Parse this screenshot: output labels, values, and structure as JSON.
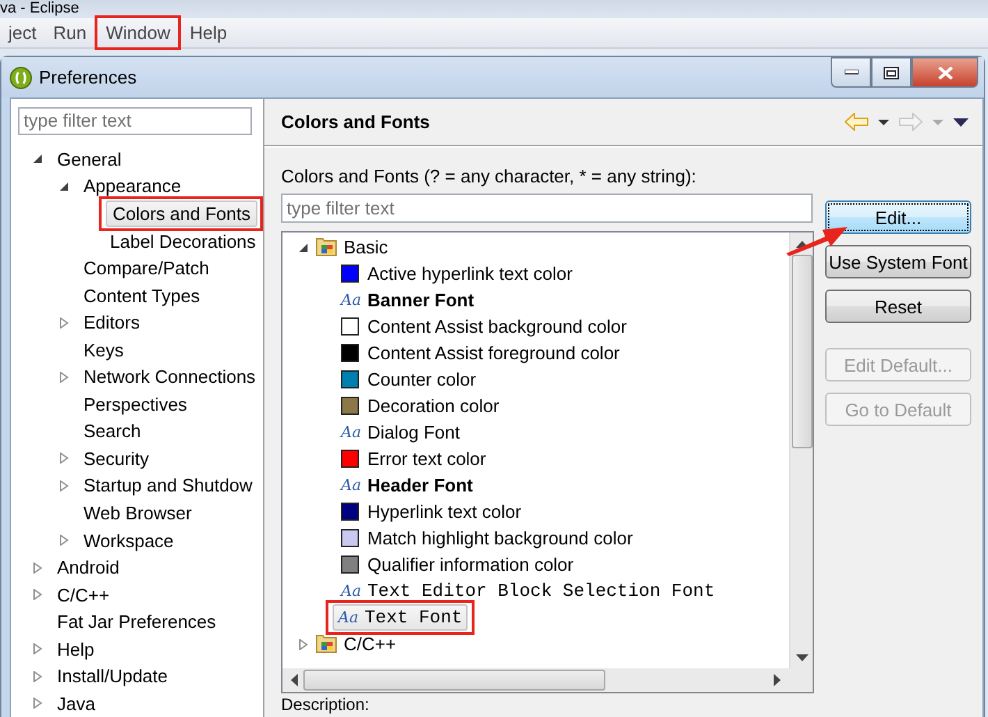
{
  "app_title": "va - Eclipse",
  "menu": [
    {
      "label": "ject",
      "annotated": false
    },
    {
      "label": "Run",
      "annotated": false
    },
    {
      "label": "Window",
      "annotated": true
    },
    {
      "label": "Help",
      "annotated": false
    }
  ],
  "dialog": {
    "title": "Preferences"
  },
  "nav_tree": {
    "filter_placeholder": "type filter text",
    "items": [
      {
        "label": "General",
        "expanded": true,
        "selected": false,
        "annotated": false,
        "children": [
          {
            "label": "Appearance",
            "expanded": true,
            "selected": false,
            "annotated": false,
            "children": [
              {
                "label": "Colors and Fonts",
                "selected": true,
                "annotated": true
              },
              {
                "label": "Label Decorations",
                "selected": false,
                "annotated": false
              }
            ]
          },
          {
            "label": "Compare/Patch",
            "selected": false,
            "annotated": false
          },
          {
            "label": "Content Types",
            "selected": false,
            "annotated": false
          },
          {
            "label": "Editors",
            "expanded": false,
            "selected": false,
            "annotated": false
          },
          {
            "label": "Keys",
            "selected": false,
            "annotated": false
          },
          {
            "label": "Network Connections",
            "expanded": false,
            "selected": false,
            "annotated": false
          },
          {
            "label": "Perspectives",
            "selected": false,
            "annotated": false
          },
          {
            "label": "Search",
            "selected": false,
            "annotated": false
          },
          {
            "label": "Security",
            "expanded": false,
            "selected": false,
            "annotated": false
          },
          {
            "label": "Startup and Shutdow",
            "expanded": false,
            "selected": false,
            "annotated": false
          },
          {
            "label": "Web Browser",
            "selected": false,
            "annotated": false
          },
          {
            "label": "Workspace",
            "expanded": false,
            "selected": false,
            "annotated": false
          }
        ]
      },
      {
        "label": "Android",
        "expanded": false,
        "selected": false,
        "annotated": false
      },
      {
        "label": "C/C++",
        "expanded": false,
        "selected": false,
        "annotated": false
      },
      {
        "label": "Fat Jar Preferences",
        "selected": false,
        "annotated": false
      },
      {
        "label": "Help",
        "expanded": false,
        "selected": false,
        "annotated": false
      },
      {
        "label": "Install/Update",
        "expanded": false,
        "selected": false,
        "annotated": false
      },
      {
        "label": "Java",
        "expanded": false,
        "selected": false,
        "annotated": false
      }
    ]
  },
  "page": {
    "title": "Colors and Fonts",
    "nav_buttons": [
      {
        "kind": "back",
        "disabled": false
      },
      {
        "kind": "forward",
        "disabled": true
      },
      {
        "kind": "menu",
        "disabled": false
      }
    ],
    "filter_label": "Colors and Fonts (? = any character, * = any string):",
    "filter_placeholder": "type filter text",
    "categories": [
      {
        "label": "Basic",
        "expanded": true,
        "children": [
          {
            "kind": "color",
            "label": "Active hyperlink text color",
            "color": "#0000ff",
            "selected": false,
            "annotated": false
          },
          {
            "kind": "boldfont",
            "icon": "Aa",
            "label": "Banner Font",
            "selected": false,
            "annotated": false
          },
          {
            "kind": "color",
            "label": "Content Assist background color",
            "color": "#ffffff",
            "selected": false,
            "annotated": false
          },
          {
            "kind": "color",
            "label": "Content Assist foreground color",
            "color": "#000000",
            "selected": false,
            "annotated": false
          },
          {
            "kind": "color",
            "label": "Counter color",
            "color": "#0080b0",
            "selected": false,
            "annotated": false
          },
          {
            "kind": "color",
            "label": "Decoration color",
            "color": "#8b7748",
            "selected": false,
            "annotated": false
          },
          {
            "kind": "font",
            "icon": "Aa",
            "label": "Dialog Font",
            "selected": false,
            "annotated": false
          },
          {
            "kind": "color",
            "label": "Error text color",
            "color": "#ff0000",
            "selected": false,
            "annotated": false
          },
          {
            "kind": "boldfont",
            "icon": "Aa",
            "label": "Header Font",
            "selected": false,
            "annotated": false
          },
          {
            "kind": "color",
            "label": "Hyperlink text color",
            "color": "#000080",
            "selected": false,
            "annotated": false
          },
          {
            "kind": "color",
            "label": "Match highlight background color",
            "color": "#c8c8f0",
            "selected": false,
            "annotated": false
          },
          {
            "kind": "color",
            "label": "Qualifier information color",
            "color": "#808080",
            "selected": false,
            "annotated": false
          },
          {
            "kind": "monofont",
            "icon": "Aa",
            "label": "Text Editor Block Selection Font",
            "selected": false,
            "annotated": false
          },
          {
            "kind": "monofont",
            "icon": "Aa",
            "label": "Text Font",
            "selected": true,
            "annotated": true
          }
        ]
      },
      {
        "label": "C/C++",
        "expanded": false
      }
    ],
    "buttons": [
      {
        "label": "Edit...",
        "disabled": false,
        "focused": true,
        "arrow": true
      },
      {
        "label": "Use System Font",
        "disabled": false,
        "focused": false,
        "arrow": false
      },
      {
        "label": "Reset",
        "disabled": false,
        "focused": false,
        "arrow": false
      },
      {
        "label": "Edit Default...",
        "disabled": true,
        "focused": false,
        "arrow": false
      },
      {
        "label": "Go to Default",
        "disabled": true,
        "focused": false,
        "arrow": false
      }
    ],
    "description_label": "Description:"
  }
}
